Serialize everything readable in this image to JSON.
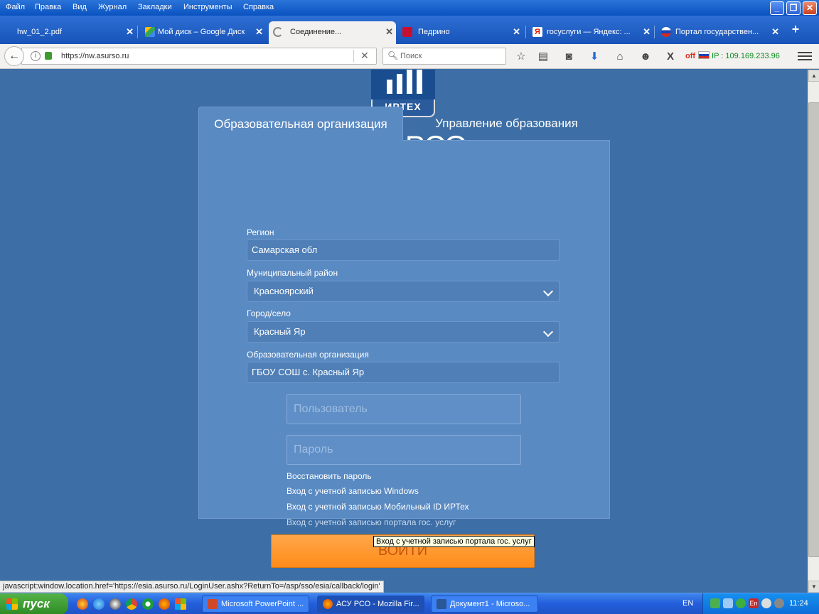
{
  "browser": {
    "menu": [
      "Файл",
      "Правка",
      "Вид",
      "Журнал",
      "Закладки",
      "Инструменты",
      "Справка"
    ],
    "tabs": [
      {
        "label": "hw_01_2.pdf",
        "icon": "pdf-icon"
      },
      {
        "label": "Мой диск – Google Диск",
        "icon": "google-drive-icon"
      },
      {
        "label": "Соединение...",
        "icon": "loading-spinner-icon"
      },
      {
        "label": "Педрино",
        "icon": "pedrino-icon"
      },
      {
        "label": "госуслуги — Яндекс: ...",
        "icon": "yandex-icon"
      },
      {
        "label": "Портал государствен...",
        "icon": "gosuslugi-icon"
      }
    ],
    "new_tab": "+",
    "url": "https://nw.asurso.ru",
    "url_clear": "✕",
    "search_placeholder": "Поиск",
    "ip_off": "off",
    "ip_text": "IP : 109.169.233.96",
    "status_url": "javascript:window.location.href='https://esia.asurso.ru/LoginUser.ashx?ReturnTo=/asp/sso/esia/callback/login'"
  },
  "page": {
    "logo_text": "ИРТЕХ",
    "title": "АСУ РСО",
    "tabs": {
      "org": "Образовательная организация",
      "mgmt": "Управление образования"
    },
    "fields": {
      "region_label": "Регион",
      "region_value": "Самарская обл",
      "district_label": "Муниципальный район",
      "district_value": "Красноярский",
      "city_label": "Город/село",
      "city_value": "Красный Яр",
      "org_label": "Образовательная организация",
      "org_value": "ГБОУ СОШ с. Красный Яр"
    },
    "username_placeholder": "Пользователь",
    "password_placeholder": "Пароль",
    "links": {
      "restore": "Восстановить пароль",
      "windows": "Вход с учетной записью Windows",
      "mobile_id": "Вход с учетной записью Мобильный ID ИРТех",
      "gosuslugi": "Вход с учетной записью портала гос. услуг"
    },
    "login_button": "ВОЙТИ",
    "tooltip": "Вход с учетной записью портала гос. услуг"
  },
  "taskbar": {
    "start": "пуск",
    "tasks": [
      {
        "label": "Microsoft PowerPoint ...",
        "icon": "powerpoint-icon"
      },
      {
        "label": "АСУ РСО - Mozilla Fir...",
        "icon": "firefox-icon"
      },
      {
        "label": "Документ1 - Microso...",
        "icon": "word-icon"
      }
    ],
    "lang": "EN",
    "clock": "11:24"
  },
  "colors": {
    "page_bg": "#3d6ea5",
    "panel_bg": "#5a8ac2",
    "login_orange": "#ff8c18",
    "taskbar_blue": "#245edb"
  }
}
